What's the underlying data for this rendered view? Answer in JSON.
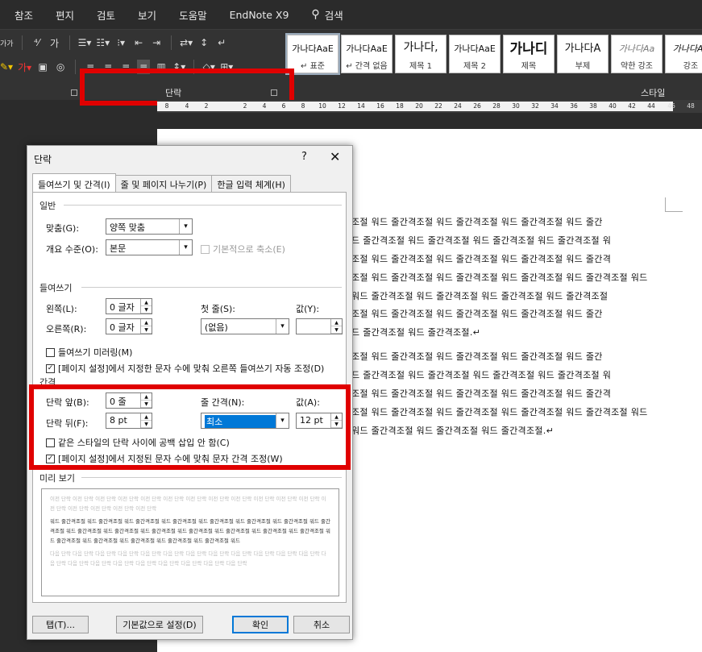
{
  "menu": {
    "items": [
      "참조",
      "편지",
      "검토",
      "보기",
      "도움말",
      "EndNote X9"
    ],
    "search_label": "검색"
  },
  "ribbon": {
    "paragraph_group_label": "단락",
    "styles_group_label": "스타일",
    "styles": [
      {
        "sample": "가나다AaE",
        "name": "↵ 표준"
      },
      {
        "sample": "가나다AaE",
        "name": "↵ 간격 없음"
      },
      {
        "sample": "가나다,",
        "name": "제목 1"
      },
      {
        "sample": "가나다AaE",
        "name": "제목 2"
      },
      {
        "sample": "가나디",
        "name": "제목"
      },
      {
        "sample": "가나다A",
        "name": "부제"
      },
      {
        "sample": "가나다Aa",
        "name": "약한 강조"
      },
      {
        "sample": "가나다Aa",
        "name": "강조"
      }
    ],
    "left_text": "가가"
  },
  "ruler": {
    "ticks": [
      "8",
      "4",
      "2",
      "",
      "2",
      "4",
      "6",
      "8",
      "10",
      "12",
      "14",
      "16",
      "18",
      "20",
      "22",
      "24",
      "26",
      "28",
      "30",
      "32",
      "34",
      "36",
      "38",
      "40",
      "42",
      "44",
      "46",
      "48"
    ]
  },
  "document": {
    "lines": [
      "조절 워드 줄간격조절 워드 줄간격조절 워드 줄간격조절 워드 줄간",
      "드 줄간격조절 워드 줄간격조절 워드 줄간격조절 워드 줄간격조절 워",
      "조절 워드 줄간격조절 워드 줄간격조절 워드 줄간격조절 워드 줄간격",
      "조절 워드 줄간격조절 워드 줄간격조절 워드 줄간격조절 워드 줄간격조절 워드",
      "워드 줄간격조절 워드 줄간격조절 워드 줄간격조절 워드 줄간격조절",
      "조절 워드 줄간격조절 워드 줄간격조절 워드 줄간격조절 워드 줄간",
      "드 줄간격조절 워드 줄간격조절.↵",
      "조절 워드 줄간격조절 워드 줄간격조절 워드 줄간격조절 워드 줄간",
      "드 줄간격조절 워드 줄간격조절 워드 줄간격조절 워드 줄간격조절 워",
      "조절 워드 줄간격조절 워드 줄간격조절 워드 줄간격조절 워드 줄간격",
      "조절 워드 줄간격조절 워드 줄간격조절 워드 줄간격조절 워드 줄간격조절 워드",
      "워드 줄간격조절 워드 줄간격조절 워드 줄간격조절.↵"
    ]
  },
  "dialog": {
    "title": "단락",
    "help": "?",
    "close": "✕",
    "tabs": [
      "들여쓰기 및 간격(I)",
      "줄 및 페이지 나누기(P)",
      "한글 입력 체계(H)"
    ],
    "general": {
      "section": "일반",
      "alignment_label": "맞춤(G):",
      "alignment_value": "양쪽 맞춤",
      "outline_label": "개요 수준(O):",
      "outline_value": "본문",
      "collapsed_label": "기본적으로 축소(E)"
    },
    "indent": {
      "section": "들여쓰기",
      "left_label": "왼쪽(L):",
      "left_value": "0 글자",
      "right_label": "오른쪽(R):",
      "right_value": "0 글자",
      "special_label": "첫 줄(S):",
      "special_value": "(없음)",
      "by_label": "값(Y):",
      "by_value": "",
      "mirror_label": "들여쓰기 미러링(M)",
      "auto_adjust_label": "[페이지 설정]에서 지정한 문자 수에 맞춰 오른쪽 들여쓰기 자동 조정(D)"
    },
    "spacing": {
      "section": "간격",
      "before_label": "단락 앞(B):",
      "before_value": "0 줄",
      "after_label": "단락 뒤(F):",
      "after_value": "8 pt",
      "line_spacing_label": "줄 간격(N):",
      "line_spacing_value": "최소",
      "at_label": "값(A):",
      "at_value": "12 pt",
      "no_space_label": "같은 스타일의 단락 사이에 공백 삽입 안 함(C)",
      "grid_label": "[페이지 설정]에서 지정된 문자 수에 맞춰 문자 간격 조정(W)"
    },
    "preview": {
      "section": "미리 보기",
      "prev_text": "이전 단락 이전 단락 이전 단락 이전 단락 이전 단락 이전 단락 이전 단락 이전 단락 이전 단락 이전 단락 이전 단락 이전 단락 이전 단락 이전 단락 이전 단락 이전 단락 이전 단락",
      "sample_text": "워드 줄간격조절 워드 줄간격조절 워드 줄간격조절 워드 줄간격조절 워드 줄간격조절 워드 줄간격조절 워드 줄간격조절 워드 줄간격조절 워드 줄간격조절 워드 줄간격조절 워드 줄간격조절 워드 줄간격조절 워드 줄간격조절 워드 줄간격조절 워드 줄간격조절 워드 줄간격조절 워드 줄간격조절 워드 줄간격조절 워드 줄간격조절 워드 줄간격조절 워드",
      "next_text": "다음 단락 다음 단락 다음 단락 다음 단락 다음 단락 다음 단락 다음 단락 다음 단락 다음 단락 다음 단락 다음 단락 다음 단락 다음 단락 다음 단락 다음 단락 다음 단락 다음 단락 다음 단락 다음 단락 다음 단락 다음 단락"
    },
    "buttons": {
      "tabs": "탭(T)...",
      "set_default": "기본값으로 설정(D)",
      "ok": "확인",
      "cancel": "취소"
    }
  },
  "colors": {
    "highlight_red": "#e00000",
    "selection_blue": "#0078d7"
  }
}
